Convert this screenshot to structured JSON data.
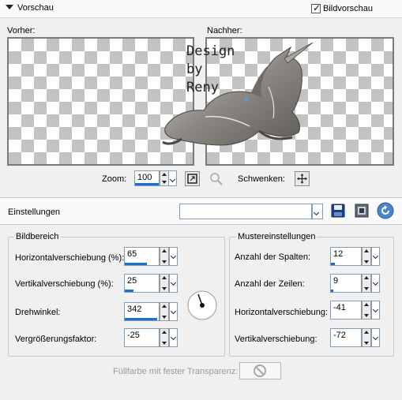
{
  "header": {
    "title": "Vorschau",
    "preview_checkbox_label": "Bildvorschau",
    "preview_checked": true
  },
  "preview": {
    "before_label": "Vorher:",
    "after_label": "Nachher:",
    "watermark_lines": [
      "Design",
      "by",
      "Reny"
    ],
    "zoom_label": "Zoom:",
    "zoom_value": "100",
    "pan_label": "Schwenken:"
  },
  "settings": {
    "label": "Einstellungen",
    "preset_value": ""
  },
  "bildbereich": {
    "title": "Bildbereich",
    "fields": [
      {
        "label": "Horizontalverschiebung (%):",
        "value": "65",
        "fill": 0.65
      },
      {
        "label": "Vertikalverschiebung (%):",
        "value": "25",
        "fill": 0.25
      },
      {
        "label": "Drehwinkel:",
        "value": "342",
        "fill": 0.95
      },
      {
        "label": "Vergrößerungsfaktor:",
        "value": "-25",
        "fill": 0.0
      }
    ]
  },
  "mustereinstellungen": {
    "title": "Mustereinstellungen",
    "fields": [
      {
        "label": "Anzahl der Spalten:",
        "value": "12",
        "fill": 0.12
      },
      {
        "label": "Anzahl der Zeilen:",
        "value": "9",
        "fill": 0.09
      },
      {
        "label": "Horizontalverschiebung:",
        "value": "-41",
        "fill": 0.0
      },
      {
        "label": "Vertikalverschiebung:",
        "value": "-72",
        "fill": 0.0
      }
    ]
  },
  "fill_label": "Füllfarbe mit fester Transparenz:",
  "colors": {
    "accent": "#1f6fd1",
    "preview_border": "#7a7a7a"
  }
}
